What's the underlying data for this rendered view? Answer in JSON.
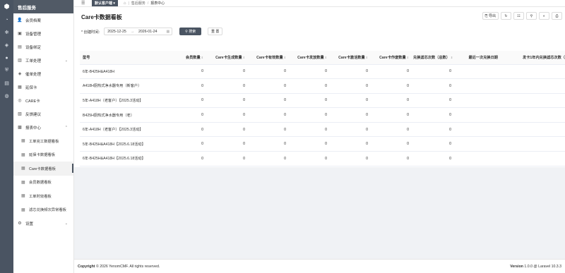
{
  "brand": {
    "name": "售后服务"
  },
  "iconbar": {
    "icons": [
      "logo-cube-icon",
      "dashboard-icon",
      "puzzle-icon",
      "layers-icon",
      "user-icon",
      "shield-icon",
      "list-icon",
      "globe-icon"
    ]
  },
  "sidebar": {
    "items": [
      {
        "label": "会员档案",
        "icon": "👤"
      },
      {
        "label": "设备管理",
        "icon": "▣"
      },
      {
        "label": "设备绑定",
        "icon": "▤"
      },
      {
        "label": "工单处理",
        "icon": "▥",
        "chevron": "⌄"
      },
      {
        "label": "催单处理",
        "icon": "◈"
      },
      {
        "label": "延保卡",
        "icon": "▦"
      },
      {
        "label": "CARE卡",
        "icon": "◎"
      },
      {
        "label": "反馈建议",
        "icon": "▧"
      },
      {
        "label": "报表中心",
        "icon": "▩",
        "chevron": "⌃"
      }
    ],
    "subitems": [
      {
        "label": "工单完工数据看板"
      },
      {
        "label": "延保卡数据看板"
      },
      {
        "label": "Care卡数据看板"
      },
      {
        "label": "会员数据看板"
      },
      {
        "label": "工单时效看板"
      },
      {
        "label": "滤芯兑换频次异常看板"
      }
    ],
    "settings": {
      "label": "设置",
      "icon": "⚙",
      "chevron": "⌄"
    }
  },
  "topbar": {
    "dropdown": "默认客户端",
    "breadcrumb": [
      "售后服务",
      "报表中心"
    ]
  },
  "page": {
    "title": "Care卡数据看板"
  },
  "toolbar": {
    "export_label": "导出"
  },
  "filter": {
    "label": "* 创建时间:",
    "start": "2025-12-25",
    "arrow": "→",
    "end": "2026-01-24",
    "search_label": "搜索",
    "reset_label": "重 置"
  },
  "table": {
    "columns": [
      "型号",
      "会员数量",
      "Care卡生成数量",
      "Care卡有效数量",
      "Care卡发放数量",
      "Care卡激活数量",
      "Care卡作废数量",
      "兑换滤芯次数（总数）",
      "最近一次兑换日期",
      "发卡1年内兑换滤芯次数（"
    ],
    "rows": [
      [
        "6年-B425H&A418H",
        "0",
        "0",
        "0",
        "0",
        "0",
        "0",
        "0",
        "",
        ""
      ],
      [
        "A418H厨热式净水器专用（新客户）",
        "0",
        "0",
        "0",
        "0",
        "0",
        "0",
        "0",
        "",
        ""
      ],
      [
        "5年-A418H（老客户）【2025.3活动】",
        "0",
        "0",
        "0",
        "0",
        "0",
        "0",
        "0",
        "",
        ""
      ],
      [
        "B425H厨热式净水器专用（老）",
        "0",
        "0",
        "0",
        "0",
        "0",
        "0",
        "0",
        "",
        ""
      ],
      [
        "6年-A418H（老客户）【2025.3活动】",
        "0",
        "0",
        "0",
        "0",
        "0",
        "0",
        "0",
        "",
        ""
      ],
      [
        "5年-B425H&A418H【2025.6.18活动】",
        "0",
        "0",
        "0",
        "0",
        "0",
        "0",
        "0",
        "",
        ""
      ],
      [
        "6年-B425H&A418H【2025.6.18活动】",
        "0",
        "0",
        "0",
        "0",
        "0",
        "0",
        "0",
        "",
        ""
      ]
    ]
  },
  "footer": {
    "copyright_prefix": "Copyright",
    "copyright_rest": "© 2026 YenomCMF. All rights reserved.",
    "version_prefix": "Version",
    "version_rest": "1.0.0 @ Laravel 10.3.3"
  }
}
